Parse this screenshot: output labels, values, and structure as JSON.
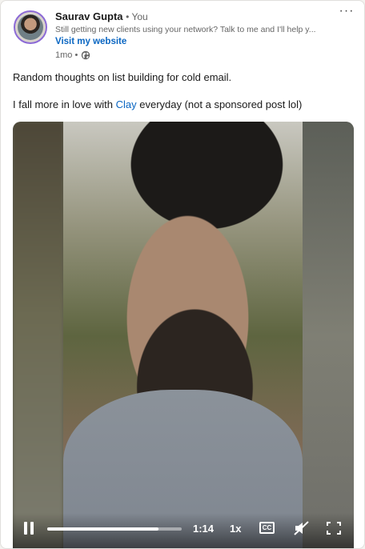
{
  "author": {
    "name": "Saurav Gupta",
    "relation": "• You",
    "headline": "Still getting new clients using your network? Talk to me and I'll help y...",
    "website_label": "Visit my website",
    "time_ago": "1mo •",
    "visibility_icon": "globe-icon",
    "avatar_ring_color": "#8c6ad6"
  },
  "post": {
    "line1": "Random thoughts on list building for cold email.",
    "line2_before": "I fall more in love with ",
    "line2_link": "Clay",
    "line2_after": " everyday (not a sponsored post lol)"
  },
  "menu": {
    "more_label": "···"
  },
  "video": {
    "elapsed_time": "1:14",
    "speed": "1x",
    "captions_label": "CC",
    "progress_fraction": 0.83,
    "state": "playing",
    "muted": true
  },
  "colors": {
    "link": "#0a66c2",
    "muted_text": "#666666"
  }
}
